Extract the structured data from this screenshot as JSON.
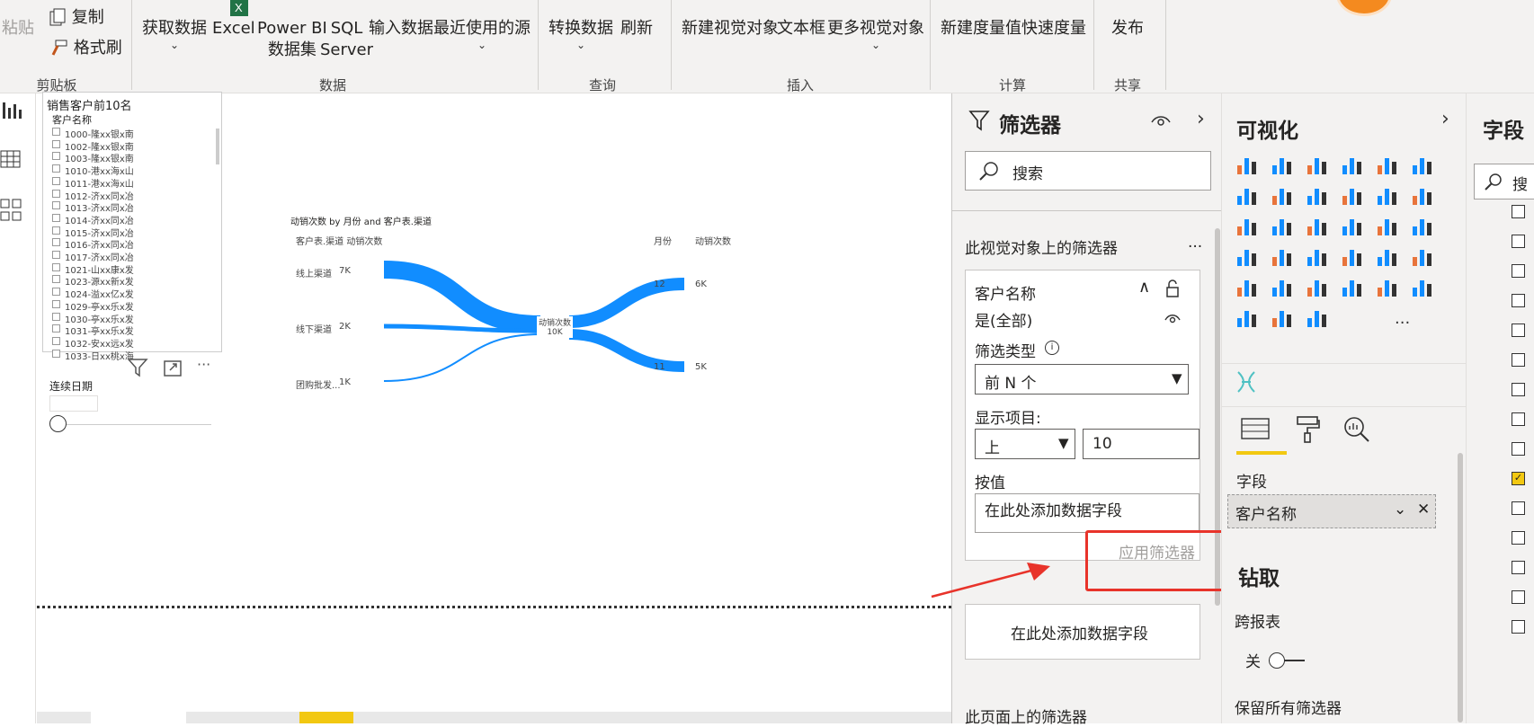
{
  "ribbon": {
    "clipboard": {
      "paste": "粘贴",
      "copy": "复制",
      "format_painter": "格式刷",
      "group": "剪贴板"
    },
    "data": {
      "get_data": "获取数据",
      "excel": "Excel",
      "powerbi_line1": "Power BI",
      "powerbi_line2": "数据集",
      "sql_line1": "SQL",
      "sql_line2": "Server",
      "enter_data": "输入数据",
      "recent_sources": "最近使用的源",
      "group": "数据"
    },
    "query": {
      "transform": "转换数据",
      "refresh": "刷新",
      "group": "查询"
    },
    "insert": {
      "new_visual": "新建视觉对象",
      "textbox": "文本框",
      "more_visuals": "更多视觉对象",
      "group": "插入"
    },
    "calc": {
      "new_measure": "新建度量值",
      "quick_measure": "快速度量",
      "group": "计算"
    },
    "share": {
      "publish": "发布",
      "group": "共享"
    }
  },
  "slicer": {
    "title": "销售客户前10名",
    "header": "客户名称",
    "items": [
      "1000-隆xx银x南",
      "1002-隆xx银x南",
      "1003-隆xx银x南",
      "1010-港xx海x山",
      "1011-港xx海x山",
      "1012-济xx同x冶",
      "1013-济xx同x冶",
      "1014-济xx同x冶",
      "1015-济xx同x冶",
      "1016-济xx同x冶",
      "1017-济xx同x冶",
      "1021-山xx康x发",
      "1023-源xx新x发",
      "1024-溢xx亿x发",
      "1029-亭xx乐x发",
      "1030-亭xx乐x发",
      "1031-亭xx乐x发",
      "1032-安xx远x发",
      "1033-日xx桃x海"
    ]
  },
  "date_slicer": {
    "label": "连续日期"
  },
  "sankey": {
    "title": "动销次数 by 月份 and 客户表.渠道",
    "left_header": "客户表.渠道 动销次数",
    "right_header_month": "月份",
    "right_header_count": "动销次数",
    "sources": [
      {
        "name": "线上渠道",
        "value": "7K"
      },
      {
        "name": "线下渠道",
        "value": "2K"
      },
      {
        "name": "团购批发...",
        "value": "1K"
      }
    ],
    "center": {
      "name": "动销次数",
      "value": "10K"
    },
    "targets": [
      {
        "name": "12",
        "value": "6K"
      },
      {
        "name": "11",
        "value": "5K"
      }
    ],
    "flow_color": "#118DFF"
  },
  "filters": {
    "title": "筛选器",
    "search_placeholder": "搜索",
    "section_visual": "此视觉对象上的筛选器",
    "more": "...",
    "card": {
      "field": "客户名称",
      "state": "是(全部)",
      "filter_type_label": "筛选类型",
      "filter_type_value": "前 N 个",
      "show_items_label": "显示项目:",
      "direction": "上",
      "count": "10",
      "by_value_label": "按值",
      "by_value_placeholder": "在此处添加数据字段",
      "apply": "应用筛选器"
    },
    "add_field": "在此处添加数据字段",
    "section_page": "此页面上的筛选器"
  },
  "viz": {
    "title": "可视化",
    "fields_label": "字段",
    "field_value": "客户名称",
    "drill_title": "钻取",
    "cross_report": "跨报表",
    "toggle_off": "关",
    "keep_filters": "保留所有筛选器",
    "more": "..."
  },
  "fields_pane": {
    "title": "字段",
    "search": "搜"
  },
  "colors": {
    "accent": "#F2C811",
    "annotation": "#E8332A",
    "brand": "#118DFF"
  }
}
